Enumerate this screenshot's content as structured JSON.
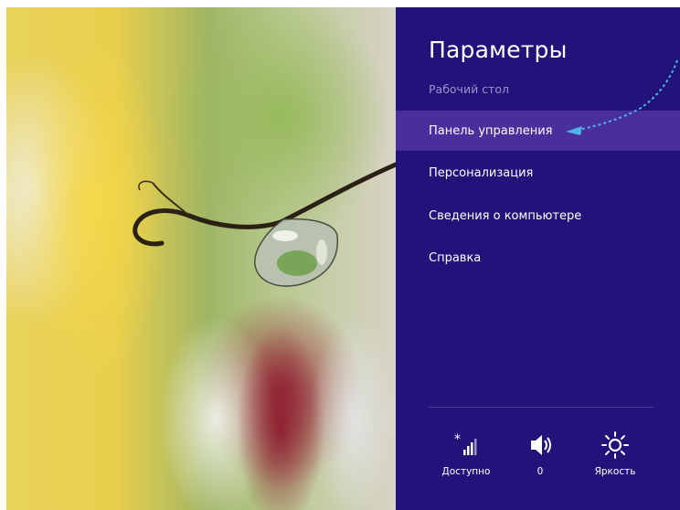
{
  "charm": {
    "title": "Параметры",
    "subtitle": "Рабочий стол",
    "items": [
      {
        "label": "Панель управления",
        "active": true
      },
      {
        "label": "Персонализация",
        "active": false
      },
      {
        "label": "Сведения о компьютере",
        "active": false
      },
      {
        "label": "Справка",
        "active": false
      }
    ],
    "quick": [
      {
        "icon": "network-icon",
        "label": "Доступно"
      },
      {
        "icon": "volume-icon",
        "label": "0"
      },
      {
        "icon": "brightness-icon",
        "label": "Яркость"
      }
    ]
  },
  "colors": {
    "panel": "#22137a",
    "highlight": "#4a2f9c",
    "subtitle": "#9b92cf",
    "annotation": "#4fb3e8"
  }
}
